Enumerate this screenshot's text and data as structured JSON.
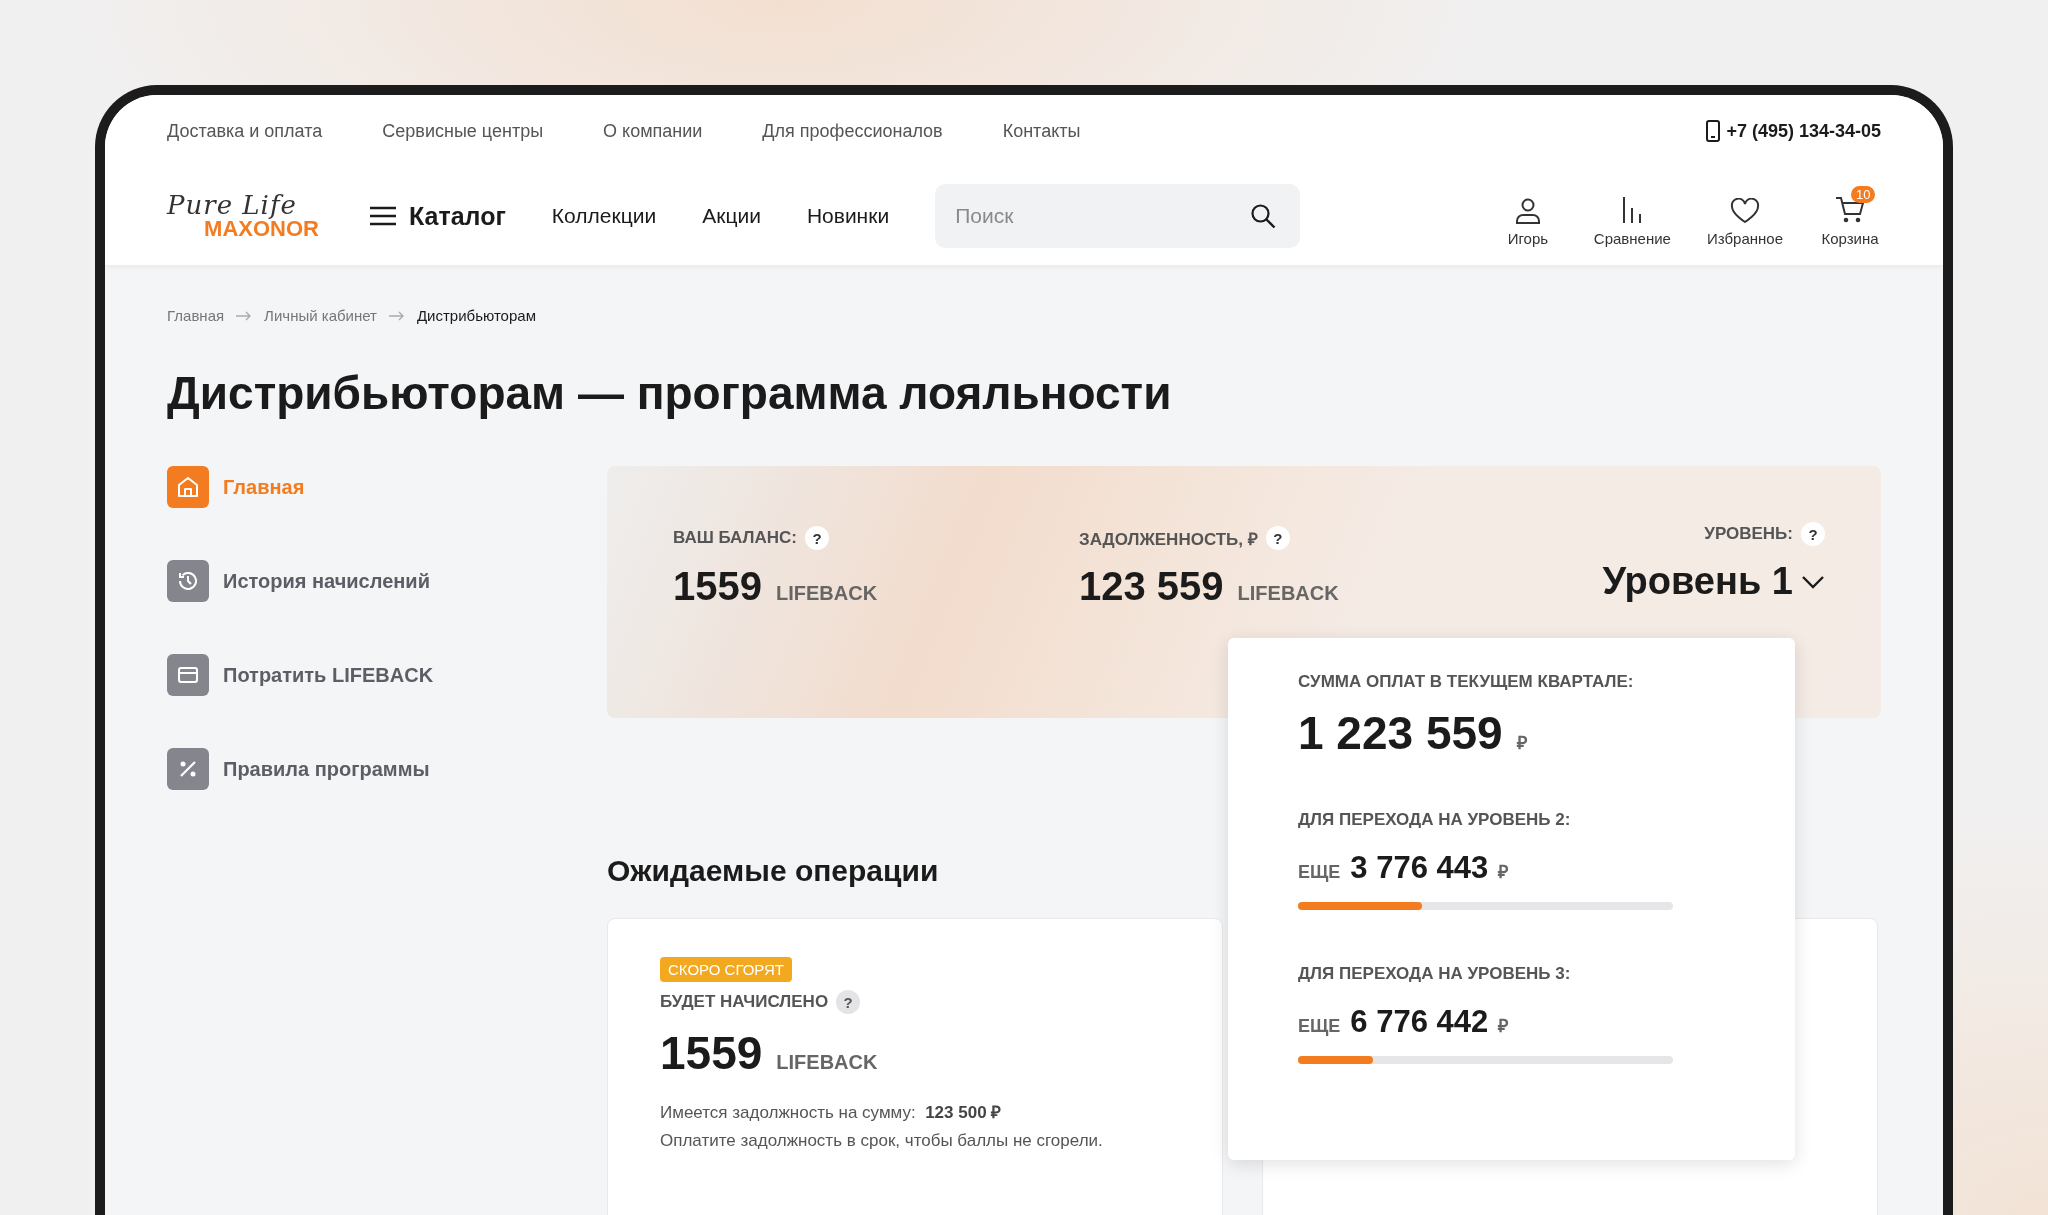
{
  "top_links": [
    "Доставка и оплата",
    "Сервисные центры",
    "О компании",
    "Для профессионалов",
    "Контакты"
  ],
  "phone": "+7 (495) 134-34-05",
  "logo": {
    "script": "Pure Life",
    "brand": "MAXONOR"
  },
  "catalog_button": "Каталог",
  "nav": [
    "Коллекции",
    "Акции",
    "Новинки"
  ],
  "search": {
    "placeholder": "Поиск"
  },
  "header_actions": [
    {
      "kind": "user",
      "label": "Игорь"
    },
    {
      "kind": "compare",
      "label": "Сравнение"
    },
    {
      "kind": "favorites",
      "label": "Избранное"
    },
    {
      "kind": "cart",
      "label": "Корзина",
      "badge": "10"
    }
  ],
  "breadcrumbs": [
    {
      "label": "Главная",
      "current": false
    },
    {
      "label": "Личный кабинет",
      "current": false
    },
    {
      "label": "Дистрибьюторам",
      "current": true
    }
  ],
  "page_title": "Дистрибьюторам — программа лояльности",
  "sidebar": {
    "items": [
      {
        "kind": "home",
        "label": "Главная",
        "selected": true
      },
      {
        "kind": "history",
        "label": "История начислений",
        "selected": false
      },
      {
        "kind": "card",
        "label": "Потратить LIFEBACK",
        "selected": false
      },
      {
        "kind": "percent",
        "label": "Правила программы",
        "selected": false
      }
    ]
  },
  "balance": {
    "stats": [
      {
        "label": "ВАШ БАЛАНС:",
        "help": "?",
        "value": "1559",
        "unit": "LIFEBACK"
      },
      {
        "label": "ЗАДОЛЖЕННОСТЬ, ₽",
        "help": "?",
        "value": "123 559",
        "unit": "LIFEBACK"
      }
    ],
    "level": {
      "label": "УРОВЕНЬ:",
      "help": "?",
      "value": "Уровень 1",
      "expanded": true
    }
  },
  "level_popup": {
    "label": "СУММА ОПЛАТ В ТЕКУЩЕМ КВАРТАЛЕ:",
    "value": "1 223 559",
    "currency": "₽",
    "steps": [
      {
        "label": "ДЛЯ ПЕРЕХОДА НА УРОВЕНЬ 2:",
        "prefix": "ЕЩЕ",
        "value": "3 776 443",
        "currency": "₽",
        "level": 0.33
      },
      {
        "label": "ДЛЯ ПЕРЕХОДА НА УРОВЕНЬ 3:",
        "prefix": "ЕЩЕ",
        "value": "6 776 442",
        "currency": "₽",
        "level": 0.2
      }
    ]
  },
  "pending": {
    "title": "Ожидаемые операции",
    "cards": [
      {
        "kind": "operation",
        "badge": "СКОРО СГОРЯТ",
        "label": "БУДЕТ НАЧИСЛЕНО",
        "help": "?",
        "value": "1559",
        "unit": "LIFEBACK",
        "debt": "Имеется задолжность на сумму:  **123 500 ₽**",
        "note": "Оплатите задолжность в срок, чтобы баллы не сгорели."
      },
      {
        "kind": "covered"
      }
    ]
  }
}
